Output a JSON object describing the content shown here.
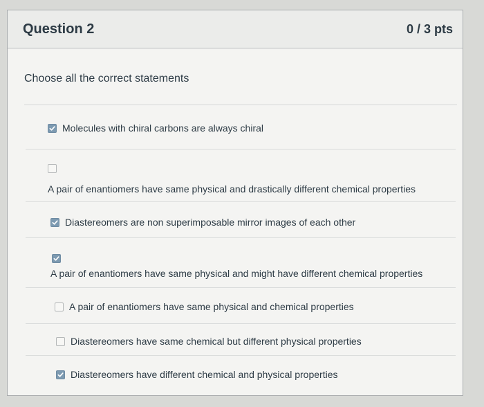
{
  "question": {
    "title": "Question 2",
    "points": "0 / 3 pts",
    "prompt": "Choose all the correct statements"
  },
  "answers": [
    {
      "label": "Molecules with chiral carbons are always chiral",
      "checked": true
    },
    {
      "label": "A pair of enantiomers have same physical and drastically different chemical properties",
      "checked": false
    },
    {
      "label": "Diastereomers are non superimposable mirror images of each other",
      "checked": true
    },
    {
      "label": "A pair of enantiomers have same physical and might have different chemical properties",
      "checked": true
    },
    {
      "label": "A pair of enantiomers have same physical and chemical properties",
      "checked": false
    },
    {
      "label": "Diastereomers have same chemical but different physical properties",
      "checked": false
    },
    {
      "label": "Diastereomers have different chemical and physical properties",
      "checked": true
    }
  ],
  "icons": {
    "checked": "check-icon",
    "checkbox": "checkbox-icon"
  },
  "colors": {
    "checked_fill": "#7d9ab1",
    "text": "#2d3b45",
    "card": "#f4f4f2"
  }
}
